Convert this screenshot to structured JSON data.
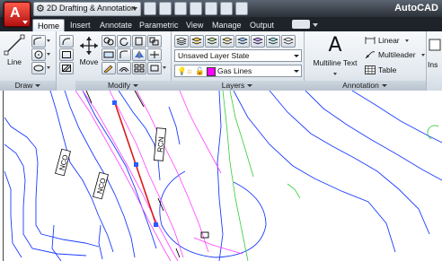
{
  "app": {
    "logo_letter": "A",
    "workspace": "2D Drafting & Annotation",
    "title": "AutoCAD"
  },
  "tabs": [
    "Home",
    "Insert",
    "Annotate",
    "Parametric",
    "View",
    "Manage",
    "Output"
  ],
  "active_tab": "Home",
  "ribbon": {
    "draw": {
      "title": "Draw",
      "line_label": "Line"
    },
    "modify": {
      "title": "Modify",
      "move_label": "Move"
    },
    "layers": {
      "title": "Layers",
      "layer_state": "Unsaved Layer State",
      "current_layer": "Gas Lines",
      "current_layer_color": "#ff00ff"
    },
    "annotation": {
      "title": "Annotation",
      "multiline_text_label": "Multiline Text",
      "linear_label": "Linear",
      "multileader_label": "Multileader",
      "table_label": "Table",
      "insert_partial": "Ins"
    }
  },
  "drawing": {
    "labels": [
      "RCN",
      "NCO",
      "NCO",
      "RCN"
    ],
    "colors": {
      "contours": "#1a3cff",
      "utilities": "#ff40ff",
      "grade": "#33cc33",
      "selected": "#d81b1b",
      "text": "#000000"
    }
  }
}
